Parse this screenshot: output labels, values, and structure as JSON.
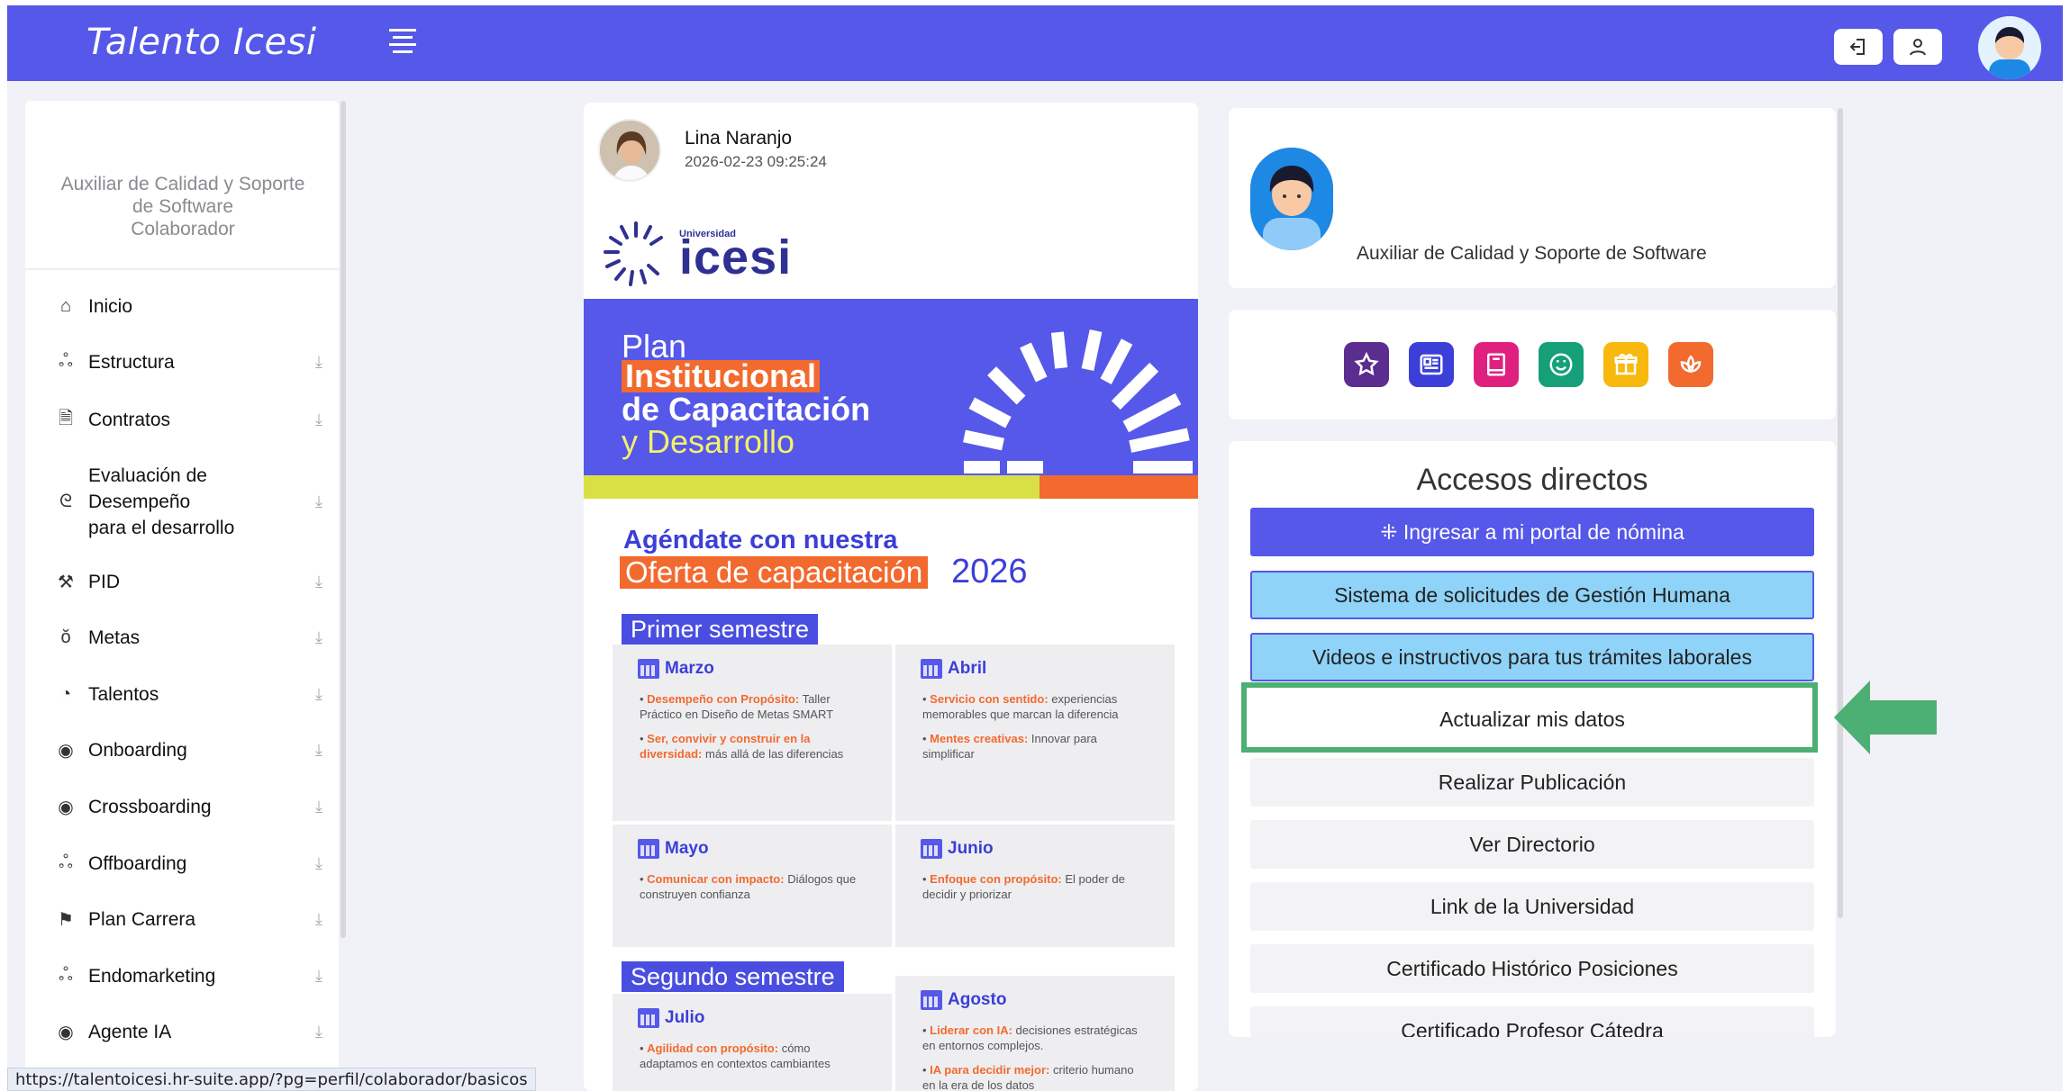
{
  "topbar": {
    "brand": "Talento Icesi",
    "bg_color": "#5558e8",
    "icons": [
      "menu-icon",
      "logout-icon",
      "user-icon",
      "avatar"
    ]
  },
  "sidebar": {
    "role_line1": "Auxiliar de Calidad y Soporte",
    "role_line2": "de Software",
    "role_line3": "Colaborador",
    "items": [
      {
        "label": "Inicio",
        "icon": "home-icon"
      },
      {
        "label": "Estructura",
        "icon": "org-chart-icon"
      },
      {
        "label": "Contratos",
        "icon": "document-icon"
      },
      {
        "label": "Evaluación de",
        "label2": "Desempeño",
        "label3": "para el desarrollo",
        "icon": "evaluation-icon"
      },
      {
        "label": "PID",
        "icon": "tools-icon"
      },
      {
        "label": "Metas",
        "icon": "target-icon"
      },
      {
        "label": "Talentos",
        "icon": "gauge-icon"
      },
      {
        "label": "Onboarding",
        "icon": "circle-dot-icon"
      },
      {
        "label": "Crossboarding",
        "icon": "circle-dot-icon"
      },
      {
        "label": "Offboarding",
        "icon": "user-exit-icon"
      },
      {
        "label": "Plan Carrera",
        "icon": "flag-icon"
      },
      {
        "label": "Endomarketing",
        "icon": "org-chart-icon"
      },
      {
        "label": "Agente IA",
        "icon": "eye-icon"
      }
    ],
    "chevron": "⤓"
  },
  "statusbar": {
    "url": "https://talentoicesi.hr-suite.app/?pg=perfil/colaborador/basicos"
  },
  "post": {
    "author": "Lina Naranjo",
    "date": "2026-02-23 09:25:24",
    "logo_small": "Universidad",
    "logo_big": "icesi",
    "banner": {
      "line1": "Plan",
      "line2": "Institucional",
      "line3": "de Capacitación",
      "line4": "y Desarrollo"
    },
    "agenda": {
      "line1": "Agéndate con nuestra",
      "line2": "Oferta de capacitación",
      "year": "2026"
    },
    "semester1": "Primer semestre",
    "semester2": "Segundo semestre",
    "months": {
      "marzo": {
        "title": "Marzo",
        "i1b": "Desempeño con Propósito:",
        "i1": "Taller Práctico en Diseño de Metas SMART",
        "i2b": "Ser, convivir y construir en la diversidad:",
        "i2": "más allá de las diferencias"
      },
      "abril": {
        "title": "Abril",
        "i1b": "Servicio con sentido:",
        "i1": "experiencias memorables que marcan la diferencia",
        "i2b": "Mentes creativas:",
        "i2": "Innovar para simplificar"
      },
      "mayo": {
        "title": "Mayo",
        "i1b": "Comunicar con impacto:",
        "i1": "Diálogos que construyen confianza"
      },
      "junio": {
        "title": "Junio",
        "i1b": "Enfoque con propósito:",
        "i1": "El poder de decidir y priorizar"
      },
      "julio": {
        "title": "Julio",
        "i1b": "Agilidad con propósito:",
        "i1": "cómo adaptamos en contextos cambiantes"
      },
      "agosto": {
        "title": "Agosto",
        "i1b": "Liderar con IA:",
        "i1": "decisiones estratégicas en entornos complejos.",
        "i2b": "IA para decidir mejor:",
        "i2": "criterio humano en la era de los datos"
      }
    }
  },
  "profile": {
    "role": "Auxiliar de Calidad y Soporte de Software"
  },
  "quick_icons": [
    {
      "name": "star-icon",
      "color": "#5b2d8e"
    },
    {
      "name": "news-icon",
      "color": "#3b3fd8"
    },
    {
      "name": "book-icon",
      "color": "#e0207f"
    },
    {
      "name": "smile-icon",
      "color": "#15a07a"
    },
    {
      "name": "gift-icon",
      "color": "#f7b90e"
    },
    {
      "name": "lotus-icon",
      "color": "#f26a2e"
    }
  ],
  "accesos": {
    "title": "Accesos directos",
    "buttons": [
      "⁜ Ingresar a mi portal de nómina",
      "Sistema de solicitudes de Gestión Humana",
      "Videos e instructivos para tus trámites laborales",
      "Actualizar mis datos",
      "Realizar Publicación",
      "Ver Directorio",
      "Link de la Universidad",
      "Certificado Histórico Posiciones",
      "Certificado Profesor Cátedra"
    ]
  },
  "annotation": {
    "highlight_color": "#4caf73"
  }
}
